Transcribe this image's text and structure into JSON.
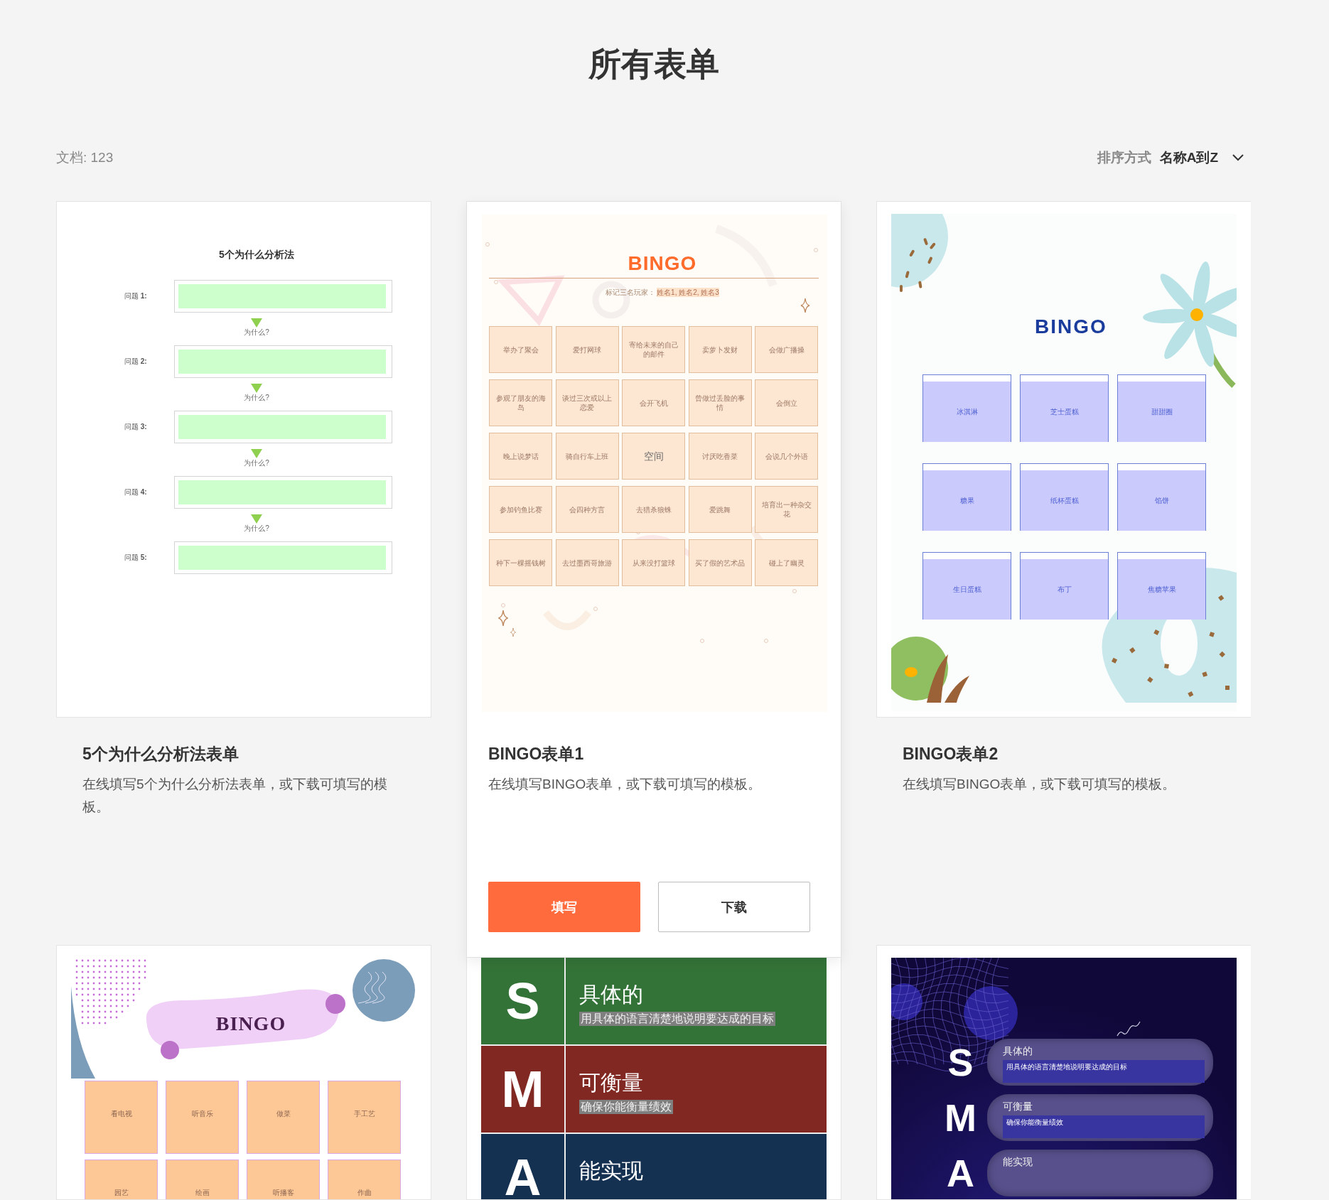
{
  "page_title": "所有表单",
  "document_count": "文档: 123",
  "sort": {
    "label": "排序方式",
    "value": "名称A到Z"
  },
  "cards": [
    {
      "title": "5个为什么分析法表单",
      "description": "在线填写5个为什么分析法表单，或下载可填写的模板。",
      "highlighted": false,
      "preview": {
        "kind": "why5",
        "heading": "5个为什么分析法",
        "questions": [
          "问题 **1:**",
          "问题 **2:**",
          "问题 **3:**",
          "问题 **4:**",
          "问题 **5:**"
        ],
        "connectors": [
          "为什么?",
          "为什么?",
          "为什么?",
          "为什么?"
        ]
      }
    },
    {
      "title": "BINGO表单1",
      "description": "在线填写BINGO表单，或下载可填写的模板。",
      "highlighted": true,
      "actions": [
        {
          "label": "填写",
          "kind": "primary"
        },
        {
          "label": "下载",
          "kind": "secondary"
        }
      ],
      "preview": {
        "kind": "bingo_classic",
        "heading": "BINGO",
        "players_label": "标记三名玩家：",
        "players": "姓名1, 姓名2, 姓名3",
        "squares": [
          {
            "text": "举办了聚会",
            "kind": "prompt"
          },
          {
            "text": "爱打网球",
            "kind": "prompt"
          },
          {
            "text": "寄给未来的自己的邮件",
            "kind": "prompt"
          },
          {
            "text": "卖萝卜发财",
            "kind": "prompt"
          },
          {
            "text": "会做广播操",
            "kind": "prompt"
          },
          {
            "text": "参观了朋友的海岛",
            "kind": "prompt"
          },
          {
            "text": "谈过三次或以上恋爱",
            "kind": "prompt"
          },
          {
            "text": "会开飞机",
            "kind": "prompt"
          },
          {
            "text": "曾做过丢脸的事情",
            "kind": "prompt"
          },
          {
            "text": "会倒立",
            "kind": "prompt"
          },
          {
            "text": "晚上说梦话",
            "kind": "prompt"
          },
          {
            "text": "骑自行车上班",
            "kind": "prompt"
          },
          {
            "text": "空间",
            "kind": "free"
          },
          {
            "text": "讨厌吃香菜",
            "kind": "prompt"
          },
          {
            "text": "会说几个外语",
            "kind": "prompt"
          },
          {
            "text": "参加钓鱼比赛",
            "kind": "prompt"
          },
          {
            "text": "会四种方言",
            "kind": "prompt"
          },
          {
            "text": "去猎杀狼蛛",
            "kind": "prompt"
          },
          {
            "text": "爱跳舞",
            "kind": "prompt"
          },
          {
            "text": "培育出一种杂交花",
            "kind": "prompt"
          },
          {
            "text": "种下一棵摇钱树",
            "kind": "prompt"
          },
          {
            "text": "去过墨西哥旅游",
            "kind": "prompt"
          },
          {
            "text": "从来没打篮球",
            "kind": "prompt"
          },
          {
            "text": "买了假的艺术品",
            "kind": "prompt"
          },
          {
            "text": "碰上了幽灵",
            "kind": "prompt"
          }
        ]
      }
    },
    {
      "title": "BINGO表单2",
      "description": "在线填写BINGO表单，或下载可填写的模板。",
      "highlighted": false,
      "preview": {
        "kind": "bingo_food",
        "heading": "BINGO",
        "squares": [
          "冰淇淋",
          "芝士蛋糕",
          "甜甜圈",
          "糖果",
          "纸杯蛋糕",
          "馅饼",
          "生日蛋糕",
          "布丁",
          "焦糖苹果"
        ]
      }
    },
    {
      "highlighted": false,
      "preview": {
        "kind": "bingo_hobby",
        "heading": "BINGO",
        "squares": [
          "看电视",
          "听音乐",
          "做菜",
          "手工艺",
          "园艺",
          "绘画",
          "听播客",
          "作曲"
        ]
      }
    },
    {
      "highlighted": false,
      "preview": {
        "kind": "smart_table",
        "rows": [
          {
            "letter": "S",
            "title": "具体的",
            "subtitle": "用具体的语言清楚地说明要达成的目标",
            "color": "#347338"
          },
          {
            "letter": "M",
            "title": "可衡量",
            "subtitle": "确保你能衡量绩效",
            "color": "#822822"
          },
          {
            "letter": "A",
            "title": "能实现",
            "color": "#153152"
          }
        ]
      }
    },
    {
      "highlighted": false,
      "preview": {
        "kind": "smart_dark",
        "rows": [
          {
            "letter": "S",
            "title": "具体的",
            "subtitle": "用具体的语言清楚地说明要达成的目标"
          },
          {
            "letter": "M",
            "title": "可衡量",
            "subtitle": "确保你能衡量绩效"
          },
          {
            "letter": "A",
            "title": "能实现"
          }
        ]
      }
    }
  ]
}
